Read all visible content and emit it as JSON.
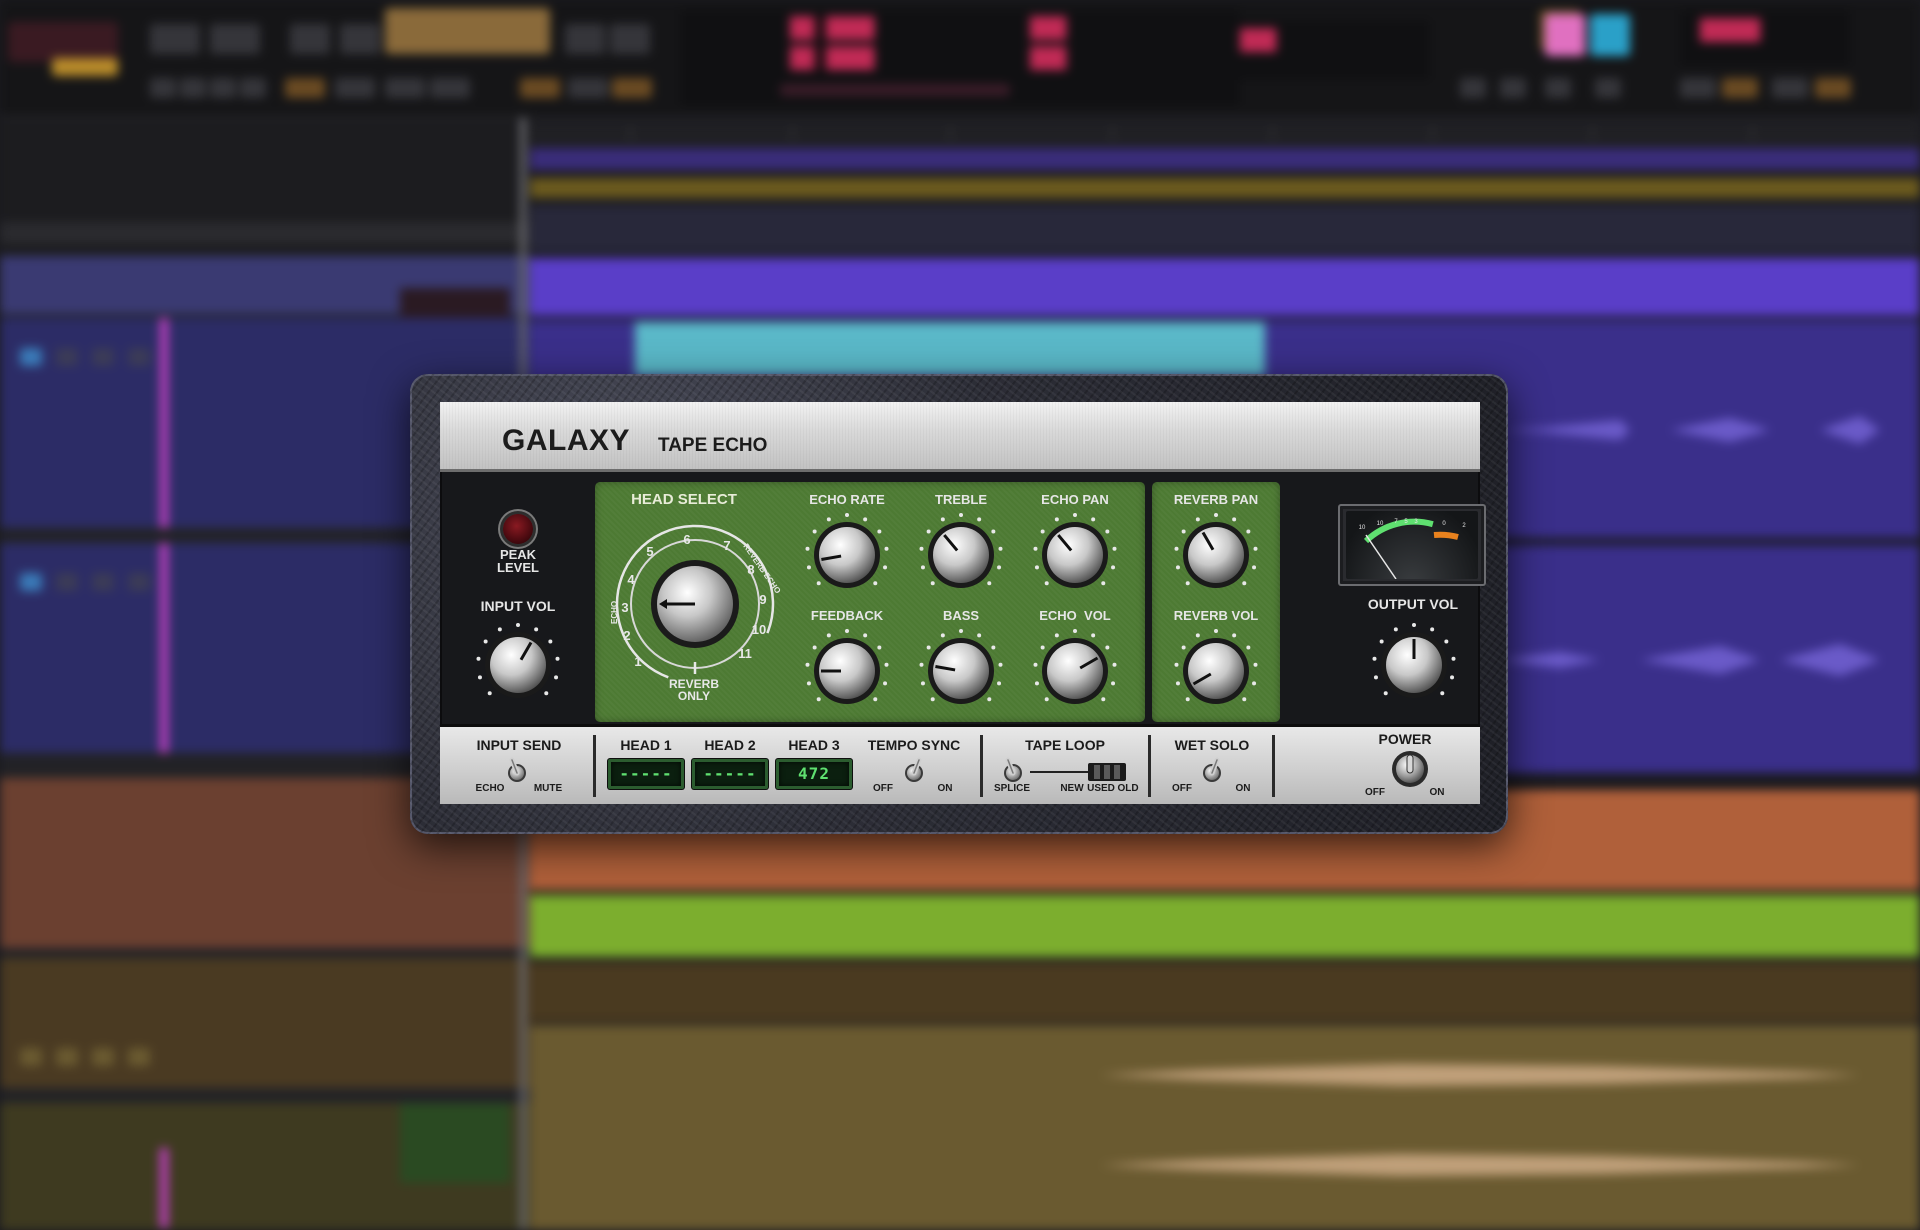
{
  "plugin": {
    "brand": "GALAXY",
    "subtitle": "TAPE ECHO",
    "peak_level_label_1": "PEAK",
    "peak_level_label_2": "LEVEL",
    "head_select": {
      "label": "HEAD SELECT",
      "numbers": [
        "1",
        "2",
        "3",
        "4",
        "5",
        "6",
        "7",
        "8",
        "9",
        "10",
        "11"
      ],
      "echo_label": "ECHO",
      "reverb_echo_label": "REVERB ECHO",
      "reverb_only_label_1": "REVERB",
      "reverb_only_label_2": "ONLY"
    },
    "knobs": {
      "input_vol": "INPUT VOL",
      "echo_rate": "ECHO RATE",
      "treble": "TREBLE",
      "echo_pan": "ECHO PAN",
      "feedback": "FEEDBACK",
      "bass": "BASS",
      "echo_vol": "ECHO  VOL",
      "reverb_pan": "REVERB PAN",
      "reverb_vol": "REVERB VOL",
      "output_vol": "OUTPUT VOL"
    },
    "vu_meter": {
      "scale": [
        "10",
        "10",
        "7",
        "5",
        "3",
        "0",
        "2"
      ],
      "accent_green": "#5fe070",
      "accent_orange": "#e8821e"
    },
    "bottom": {
      "input_send": "INPUT SEND",
      "input_send_off": "ECHO",
      "input_send_on": "MUTE",
      "head1": "HEAD 1",
      "head2": "HEAD 2",
      "head3": "HEAD 3",
      "head1_value": "-----",
      "head2_value": "-----",
      "head3_value": "472",
      "tempo_sync": "TEMPO SYNC",
      "tempo_off": "OFF",
      "tempo_on": "ON",
      "tape_loop": "TAPE LOOP",
      "tape_splice": "SPLICE",
      "tape_new": "NEW",
      "tape_used": "USED",
      "tape_old": "OLD",
      "wet_solo": "WET SOLO",
      "wet_off": "OFF",
      "wet_on": "ON",
      "power": "POWER",
      "power_off": "OFF",
      "power_on": "ON"
    }
  }
}
